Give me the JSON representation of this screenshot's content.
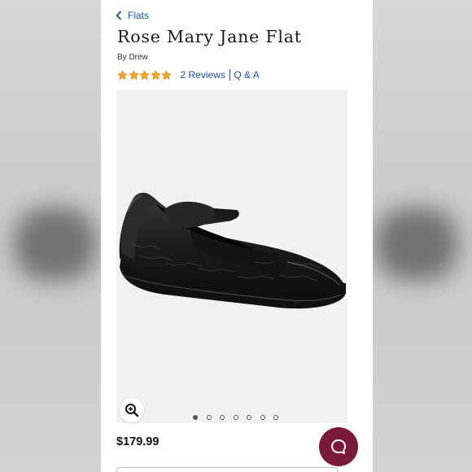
{
  "breadcrumb": {
    "label": "Flats"
  },
  "product": {
    "title": "Rose Mary Jane Flat",
    "brand": "By Drew",
    "rating": 5,
    "rating_max": 5,
    "reviews_label": "2 Reviews",
    "qa_label": "Q & A",
    "price": "$179.99"
  },
  "gallery": {
    "slide_count": 7,
    "active_index": 0
  },
  "icons": {
    "back": "chevron-left-icon",
    "zoom": "zoom-in-icon",
    "chat": "chat-bubble-icon",
    "star": "star-icon"
  },
  "colors": {
    "link": "#1f4e9a",
    "star": "#f0a32a",
    "chat_button": "#7a1a3a"
  }
}
